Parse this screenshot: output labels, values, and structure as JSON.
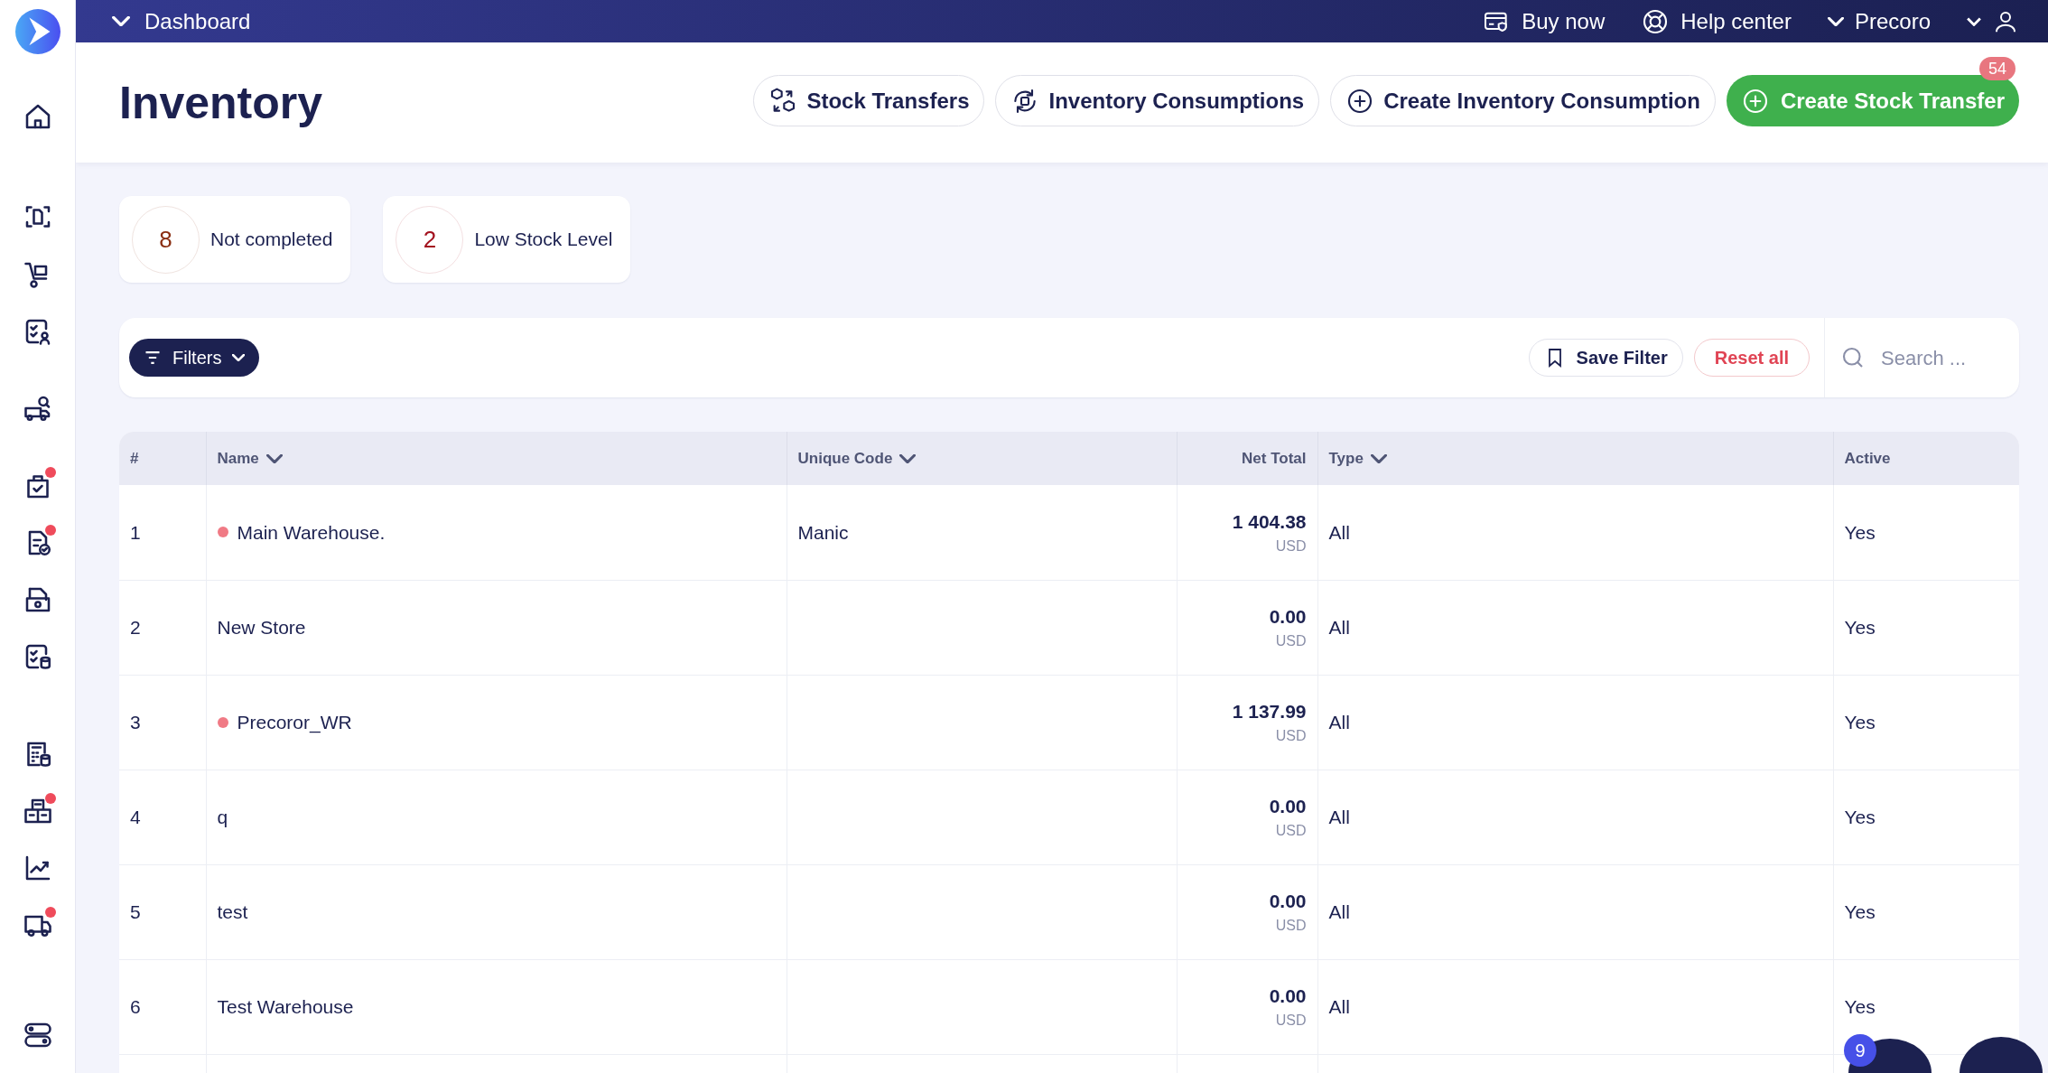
{
  "sidebar": {
    "items": [
      {
        "kind": "home",
        "dot": false
      },
      {
        "kind": "scan",
        "dot": false
      },
      {
        "kind": "cart",
        "dot": false
      },
      {
        "kind": "checklist-user",
        "dot": false
      },
      {
        "kind": "truck-search",
        "dot": false
      },
      {
        "kind": "bag-check",
        "dot": true
      },
      {
        "kind": "doc-check",
        "dot": true
      },
      {
        "kind": "wallet-doc",
        "dot": false
      },
      {
        "kind": "checklist-db",
        "dot": false
      },
      {
        "kind": "calculator",
        "dot": false
      },
      {
        "kind": "boxes",
        "dot": true
      },
      {
        "kind": "chart",
        "dot": false
      },
      {
        "kind": "truck",
        "dot": true
      },
      {
        "kind": "toggles",
        "dot": false
      }
    ]
  },
  "top_bar": {
    "menu": "Dashboard",
    "buy_now": "Buy now",
    "help_center": "Help center",
    "company": "Precoro"
  },
  "header": {
    "title": "Inventory",
    "buttons": [
      {
        "kind": "transfers",
        "label": "Stock Transfers"
      },
      {
        "kind": "consumptions",
        "label": "Inventory Consumptions"
      },
      {
        "kind": "create",
        "label": "Create Inventory Consumption"
      },
      {
        "kind": "primary",
        "label": "Create Stock Transfer",
        "badge": "54"
      }
    ]
  },
  "summary_cards": [
    {
      "count": "8",
      "label": "Not completed",
      "color": "#8a2e12"
    },
    {
      "count": "2",
      "label": "Low Stock Level",
      "color": "#a3121f"
    }
  ],
  "filter_bar": {
    "filters": "Filters",
    "save_filter": "Save Filter",
    "reset_all": "Reset all",
    "search": {
      "placeholder": "Search ..."
    }
  },
  "table": {
    "columns": [
      {
        "label": "#",
        "sortable": false
      },
      {
        "label": "Name",
        "sortable": true
      },
      {
        "label": "Unique Code",
        "sortable": true
      },
      {
        "label": "Net Total",
        "sortable": false
      },
      {
        "label": "Type",
        "sortable": true
      },
      {
        "label": "Active",
        "sortable": false
      }
    ],
    "rows": [
      {
        "number": "1",
        "name": "Main Warehouse.",
        "low_stock": true,
        "code": "Manic",
        "net_total": "1 404.38",
        "currency": "USD",
        "type": "All",
        "active": "Yes"
      },
      {
        "number": "2",
        "name": "New Store",
        "low_stock": false,
        "code": "",
        "net_total": "0.00",
        "currency": "USD",
        "type": "All",
        "active": "Yes"
      },
      {
        "number": "3",
        "name": "Precoror_WR",
        "low_stock": true,
        "code": "",
        "net_total": "1 137.99",
        "currency": "USD",
        "type": "All",
        "active": "Yes"
      },
      {
        "number": "4",
        "name": "q",
        "low_stock": false,
        "code": "",
        "net_total": "0.00",
        "currency": "USD",
        "type": "All",
        "active": "Yes"
      },
      {
        "number": "5",
        "name": "test",
        "low_stock": false,
        "code": "",
        "net_total": "0.00",
        "currency": "USD",
        "type": "All",
        "active": "Yes"
      },
      {
        "number": "6",
        "name": "Test Warehouse",
        "low_stock": false,
        "code": "",
        "net_total": "0.00",
        "currency": "USD",
        "type": "All",
        "active": "Yes"
      }
    ]
  },
  "support_launcher": {
    "badge": "9"
  }
}
